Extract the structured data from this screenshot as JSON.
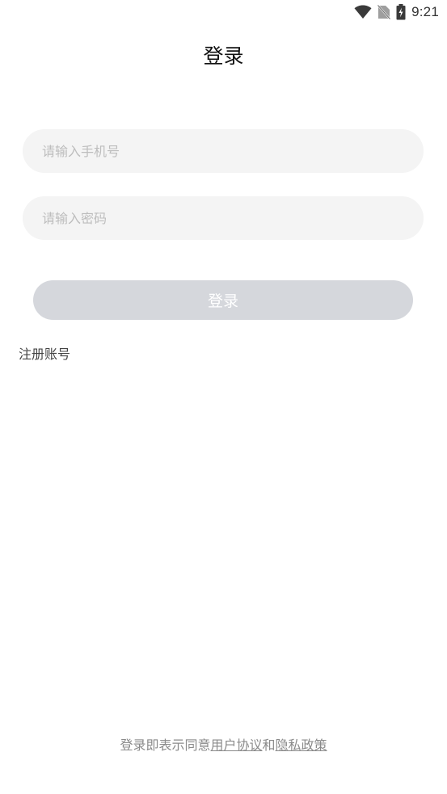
{
  "status_bar": {
    "time": "9:21",
    "icons": [
      "wifi-icon",
      "no-sim-icon",
      "battery-charging-icon"
    ]
  },
  "header": {
    "title": "登录"
  },
  "form": {
    "phone_placeholder": "请输入手机号",
    "phone_value": "",
    "password_placeholder": "请输入密码",
    "password_value": "",
    "login_label": "登录",
    "register_label": "注册账号"
  },
  "agreement": {
    "prefix": "登录即表示同意",
    "user_agreement": "用户协议",
    "conjunction": "和",
    "privacy_policy": "隐私政策"
  },
  "colors": {
    "input_bg": "#f4f4f4",
    "button_disabled_bg": "#d5d7dc",
    "placeholder": "#bdbdbd",
    "muted_text": "#8a8a8a"
  }
}
